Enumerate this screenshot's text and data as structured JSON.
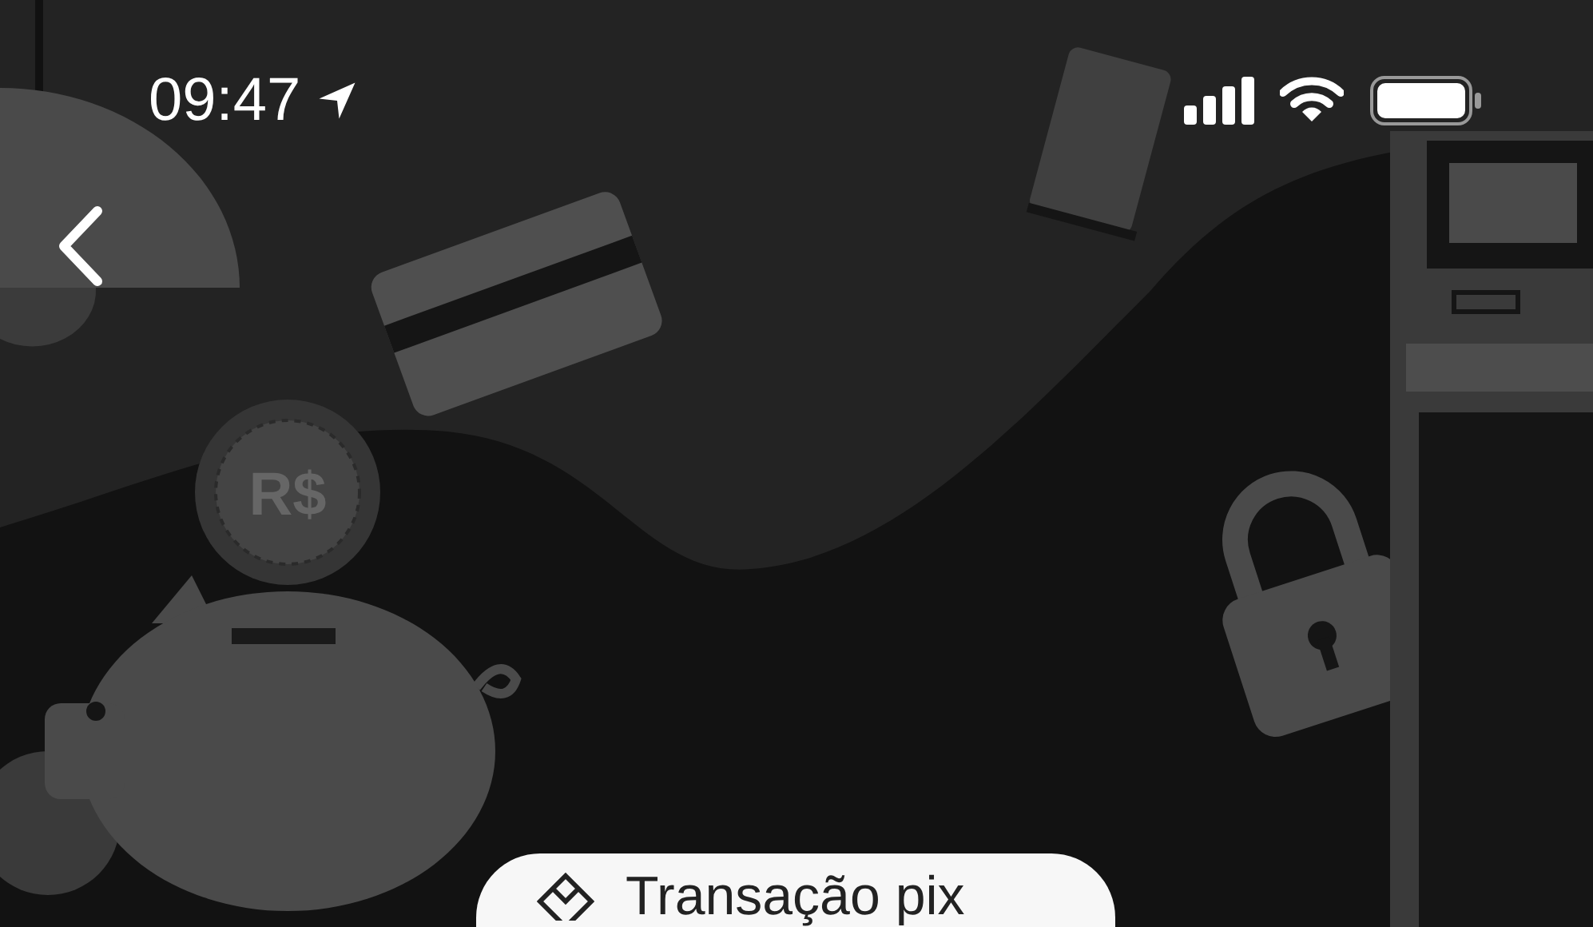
{
  "status_bar": {
    "time": "09:47"
  },
  "illustration": {
    "coin_label": "R$"
  },
  "action_pill": {
    "label": "Transação pix"
  }
}
